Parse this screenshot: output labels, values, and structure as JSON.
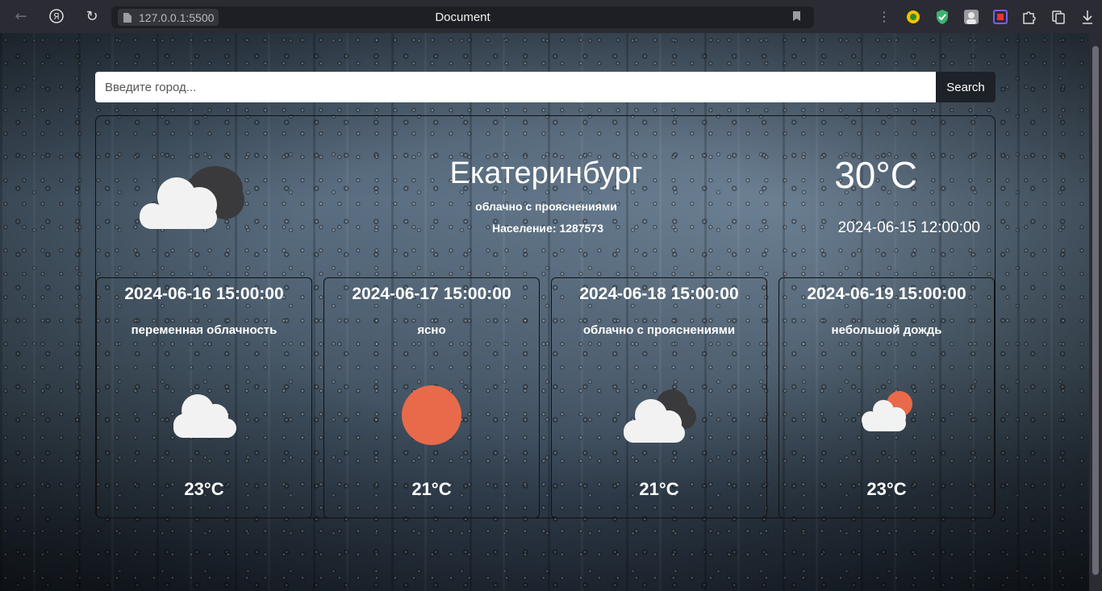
{
  "browser": {
    "url": "127.0.0.1:5500",
    "tab_title": "Document"
  },
  "search": {
    "placeholder": "Введите город...",
    "button_label": "Search"
  },
  "current": {
    "city": "Екатеринбург",
    "description": "облачно с прояснениями",
    "population_label": "Население:",
    "population_value": "1287573",
    "temperature": "30°C",
    "datetime": "2024-06-15 12:00:00",
    "icon": "cloud-partly-sun-icon"
  },
  "forecast": [
    {
      "date": "2024-06-16 15:00:00",
      "description": "переменная облачность",
      "temperature": "23°C",
      "icon": "cloud-icon"
    },
    {
      "date": "2024-06-17 15:00:00",
      "description": "ясно",
      "temperature": "21°C",
      "icon": "sun-icon"
    },
    {
      "date": "2024-06-18 15:00:00",
      "description": "облачно с прояснениями",
      "temperature": "21°C",
      "icon": "clouds-icon"
    },
    {
      "date": "2024-06-19 15:00:00",
      "description": "небольшой дождь",
      "temperature": "23°C",
      "icon": "cloud-sun-icon"
    }
  ],
  "colors": {
    "sun": "#e86a4a",
    "cloud_light": "#f2f2f2",
    "cloud_dark": "#3a3a3c",
    "search_button": "#1d2128"
  }
}
